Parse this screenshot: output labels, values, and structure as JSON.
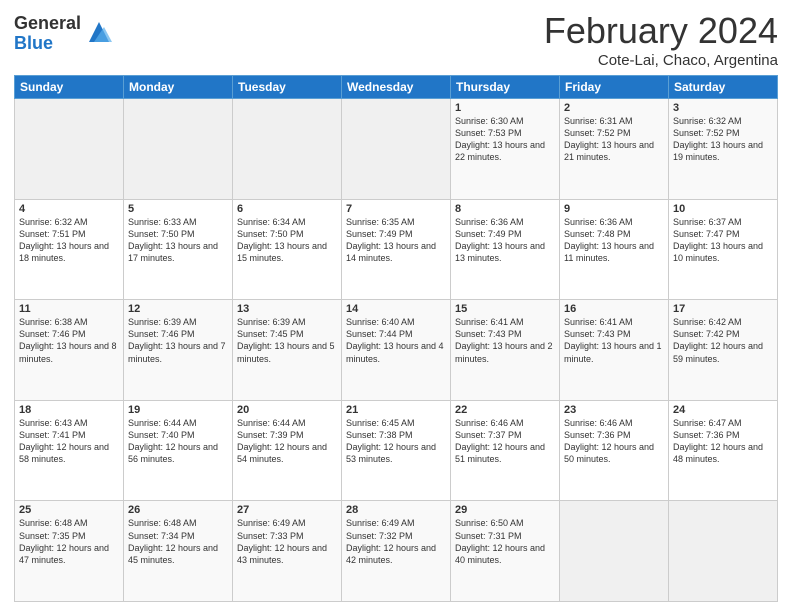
{
  "logo": {
    "general": "General",
    "blue": "Blue"
  },
  "calendar": {
    "title": "February 2024",
    "subtitle": "Cote-Lai, Chaco, Argentina",
    "days": [
      "Sunday",
      "Monday",
      "Tuesday",
      "Wednesday",
      "Thursday",
      "Friday",
      "Saturday"
    ],
    "weeks": [
      [
        {
          "day": "",
          "info": ""
        },
        {
          "day": "",
          "info": ""
        },
        {
          "day": "",
          "info": ""
        },
        {
          "day": "",
          "info": ""
        },
        {
          "day": "1",
          "info": "Sunrise: 6:30 AM\nSunset: 7:53 PM\nDaylight: 13 hours and 22 minutes."
        },
        {
          "day": "2",
          "info": "Sunrise: 6:31 AM\nSunset: 7:52 PM\nDaylight: 13 hours and 21 minutes."
        },
        {
          "day": "3",
          "info": "Sunrise: 6:32 AM\nSunset: 7:52 PM\nDaylight: 13 hours and 19 minutes."
        }
      ],
      [
        {
          "day": "4",
          "info": "Sunrise: 6:32 AM\nSunset: 7:51 PM\nDaylight: 13 hours and 18 minutes."
        },
        {
          "day": "5",
          "info": "Sunrise: 6:33 AM\nSunset: 7:50 PM\nDaylight: 13 hours and 17 minutes."
        },
        {
          "day": "6",
          "info": "Sunrise: 6:34 AM\nSunset: 7:50 PM\nDaylight: 13 hours and 15 minutes."
        },
        {
          "day": "7",
          "info": "Sunrise: 6:35 AM\nSunset: 7:49 PM\nDaylight: 13 hours and 14 minutes."
        },
        {
          "day": "8",
          "info": "Sunrise: 6:36 AM\nSunset: 7:49 PM\nDaylight: 13 hours and 13 minutes."
        },
        {
          "day": "9",
          "info": "Sunrise: 6:36 AM\nSunset: 7:48 PM\nDaylight: 13 hours and 11 minutes."
        },
        {
          "day": "10",
          "info": "Sunrise: 6:37 AM\nSunset: 7:47 PM\nDaylight: 13 hours and 10 minutes."
        }
      ],
      [
        {
          "day": "11",
          "info": "Sunrise: 6:38 AM\nSunset: 7:46 PM\nDaylight: 13 hours and 8 minutes."
        },
        {
          "day": "12",
          "info": "Sunrise: 6:39 AM\nSunset: 7:46 PM\nDaylight: 13 hours and 7 minutes."
        },
        {
          "day": "13",
          "info": "Sunrise: 6:39 AM\nSunset: 7:45 PM\nDaylight: 13 hours and 5 minutes."
        },
        {
          "day": "14",
          "info": "Sunrise: 6:40 AM\nSunset: 7:44 PM\nDaylight: 13 hours and 4 minutes."
        },
        {
          "day": "15",
          "info": "Sunrise: 6:41 AM\nSunset: 7:43 PM\nDaylight: 13 hours and 2 minutes."
        },
        {
          "day": "16",
          "info": "Sunrise: 6:41 AM\nSunset: 7:43 PM\nDaylight: 13 hours and 1 minute."
        },
        {
          "day": "17",
          "info": "Sunrise: 6:42 AM\nSunset: 7:42 PM\nDaylight: 12 hours and 59 minutes."
        }
      ],
      [
        {
          "day": "18",
          "info": "Sunrise: 6:43 AM\nSunset: 7:41 PM\nDaylight: 12 hours and 58 minutes."
        },
        {
          "day": "19",
          "info": "Sunrise: 6:44 AM\nSunset: 7:40 PM\nDaylight: 12 hours and 56 minutes."
        },
        {
          "day": "20",
          "info": "Sunrise: 6:44 AM\nSunset: 7:39 PM\nDaylight: 12 hours and 54 minutes."
        },
        {
          "day": "21",
          "info": "Sunrise: 6:45 AM\nSunset: 7:38 PM\nDaylight: 12 hours and 53 minutes."
        },
        {
          "day": "22",
          "info": "Sunrise: 6:46 AM\nSunset: 7:37 PM\nDaylight: 12 hours and 51 minutes."
        },
        {
          "day": "23",
          "info": "Sunrise: 6:46 AM\nSunset: 7:36 PM\nDaylight: 12 hours and 50 minutes."
        },
        {
          "day": "24",
          "info": "Sunrise: 6:47 AM\nSunset: 7:36 PM\nDaylight: 12 hours and 48 minutes."
        }
      ],
      [
        {
          "day": "25",
          "info": "Sunrise: 6:48 AM\nSunset: 7:35 PM\nDaylight: 12 hours and 47 minutes."
        },
        {
          "day": "26",
          "info": "Sunrise: 6:48 AM\nSunset: 7:34 PM\nDaylight: 12 hours and 45 minutes."
        },
        {
          "day": "27",
          "info": "Sunrise: 6:49 AM\nSunset: 7:33 PM\nDaylight: 12 hours and 43 minutes."
        },
        {
          "day": "28",
          "info": "Sunrise: 6:49 AM\nSunset: 7:32 PM\nDaylight: 12 hours and 42 minutes."
        },
        {
          "day": "29",
          "info": "Sunrise: 6:50 AM\nSunset: 7:31 PM\nDaylight: 12 hours and 40 minutes."
        },
        {
          "day": "",
          "info": ""
        },
        {
          "day": "",
          "info": ""
        }
      ]
    ]
  }
}
